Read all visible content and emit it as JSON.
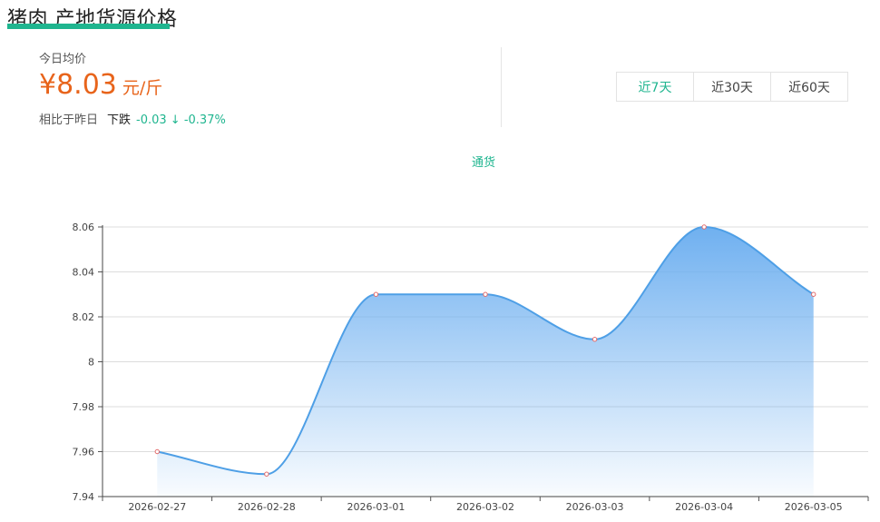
{
  "header": {
    "title": "猪肉 产地货源价格"
  },
  "summary": {
    "avg_label": "今日均价",
    "price": "¥8.03",
    "unit": "元/斤",
    "compare_label": "相比于昨日",
    "direction": "下跌",
    "change": "-0.03 ↓ -0.37%"
  },
  "range_tabs": [
    {
      "label": "近7天",
      "active": true
    },
    {
      "label": "近30天",
      "active": false
    },
    {
      "label": "近60天",
      "active": false
    }
  ],
  "colors": {
    "accent": "#1fb58f",
    "price": "#e8641b",
    "line": "#4e9fe6",
    "fill_top": "#7db8f2",
    "point": "#e36a6a"
  },
  "chart_data": {
    "type": "area",
    "title": "",
    "xlabel": "",
    "ylabel": "",
    "x": [
      "2026-02-27",
      "2026-02-28",
      "2026-03-01",
      "2026-03-02",
      "2026-03-03",
      "2026-03-04",
      "2026-03-05"
    ],
    "series": [
      {
        "name": "通货",
        "values": [
          7.96,
          7.95,
          8.03,
          8.03,
          8.01,
          8.06,
          8.03
        ]
      }
    ],
    "ylim": [
      7.94,
      8.06
    ],
    "yticks": [
      "7.94",
      "7.96",
      "7.98",
      "8",
      "8.02",
      "8.04",
      "8.06"
    ],
    "smooth": true,
    "grid": true,
    "legend_position": "top-center"
  }
}
